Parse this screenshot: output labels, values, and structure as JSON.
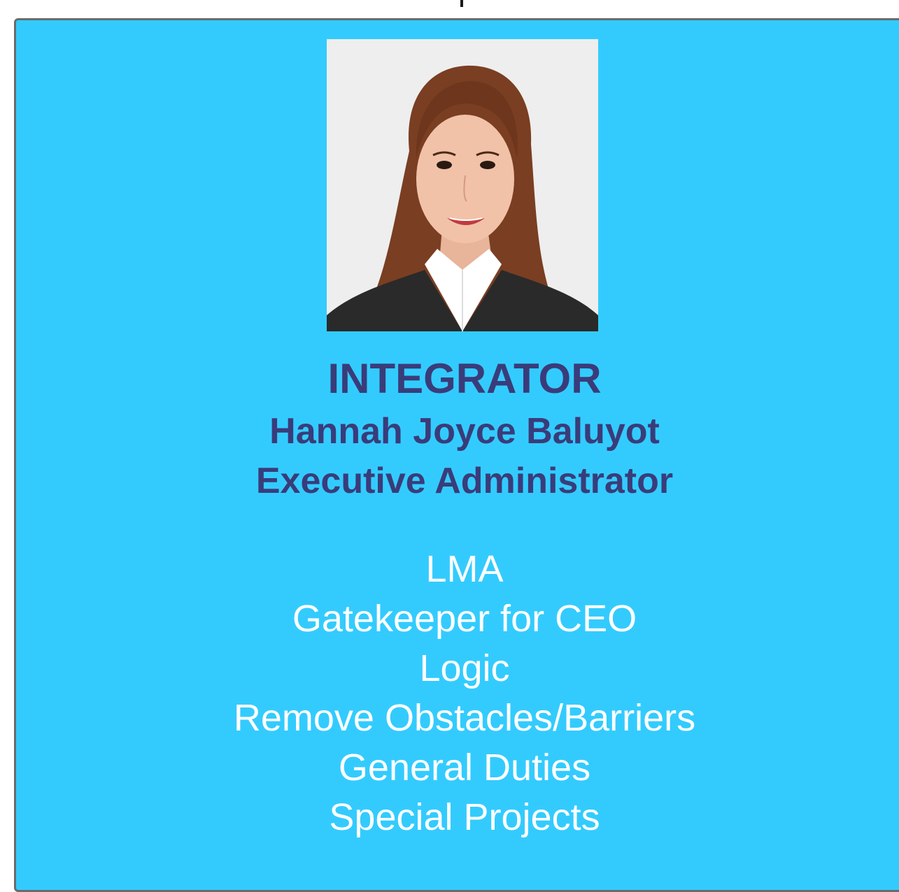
{
  "card": {
    "role": "INTEGRATOR",
    "name": "Hannah Joyce Baluyot",
    "position": "Executive Administrator",
    "duties": [
      "LMA",
      "Gatekeeper for CEO",
      "Logic",
      "Remove Obstacles/Barriers",
      "General Duties",
      "Special Projects"
    ]
  },
  "colors": {
    "card_background": "#33cbfe",
    "title_text": "#3a3c7a",
    "duty_text": "#ffffff",
    "card_border": "#6b6b6b"
  }
}
